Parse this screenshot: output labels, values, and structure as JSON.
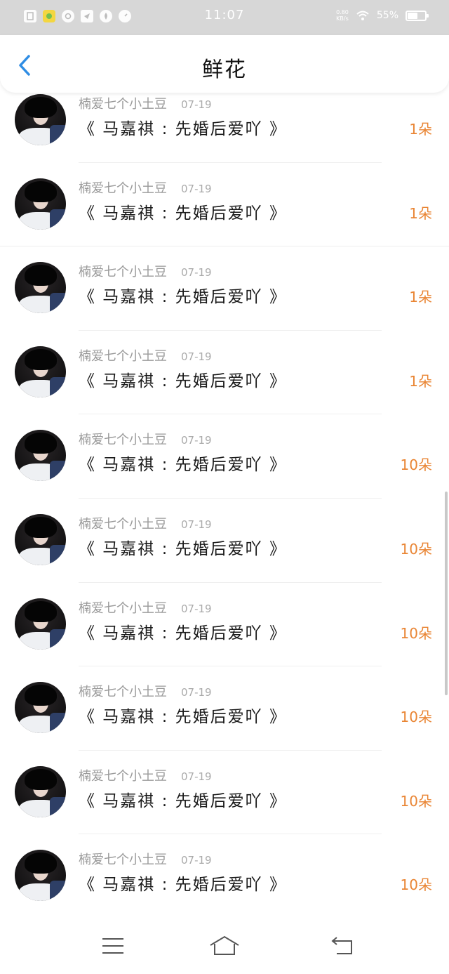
{
  "status_bar": {
    "time": "11:07",
    "net_speed_value": "0.80",
    "net_speed_unit": "KB/s",
    "battery_pct": "55%"
  },
  "header": {
    "title": "鲜花"
  },
  "list": {
    "items": [
      {
        "user": "楠爱七个小土豆",
        "date": "07-19",
        "title": "《 马嘉祺 : 先婚后爱吖 》",
        "count": "1朵"
      },
      {
        "user": "楠爱七个小土豆",
        "date": "07-19",
        "title": "《 马嘉祺 : 先婚后爱吖 》",
        "count": "1朵"
      },
      {
        "user": "楠爱七个小土豆",
        "date": "07-19",
        "title": "《 马嘉祺 : 先婚后爱吖 》",
        "count": "1朵"
      },
      {
        "user": "楠爱七个小土豆",
        "date": "07-19",
        "title": "《 马嘉祺 : 先婚后爱吖 》",
        "count": "1朵"
      },
      {
        "user": "楠爱七个小土豆",
        "date": "07-19",
        "title": "《 马嘉祺 : 先婚后爱吖 》",
        "count": "10朵"
      },
      {
        "user": "楠爱七个小土豆",
        "date": "07-19",
        "title": "《 马嘉祺 : 先婚后爱吖 》",
        "count": "10朵"
      },
      {
        "user": "楠爱七个小土豆",
        "date": "07-19",
        "title": "《 马嘉祺 : 先婚后爱吖 》",
        "count": "10朵"
      },
      {
        "user": "楠爱七个小土豆",
        "date": "07-19",
        "title": "《 马嘉祺 : 先婚后爱吖 》",
        "count": "10朵"
      },
      {
        "user": "楠爱七个小土豆",
        "date": "07-19",
        "title": "《 马嘉祺 : 先婚后爱吖 》",
        "count": "10朵"
      },
      {
        "user": "楠爱七个小土豆",
        "date": "07-19",
        "title": "《 马嘉祺 : 先婚后爱吖 》",
        "count": "10朵"
      }
    ]
  },
  "colors": {
    "accent_blue": "#2f8de4",
    "count_orange": "#e98534",
    "status_bar_bg": "#d7d7d7"
  },
  "icons": {
    "back": "chevron-left-icon",
    "nav_menu": "menu-icon",
    "nav_home": "home-icon",
    "nav_back": "back-arrow-icon"
  }
}
